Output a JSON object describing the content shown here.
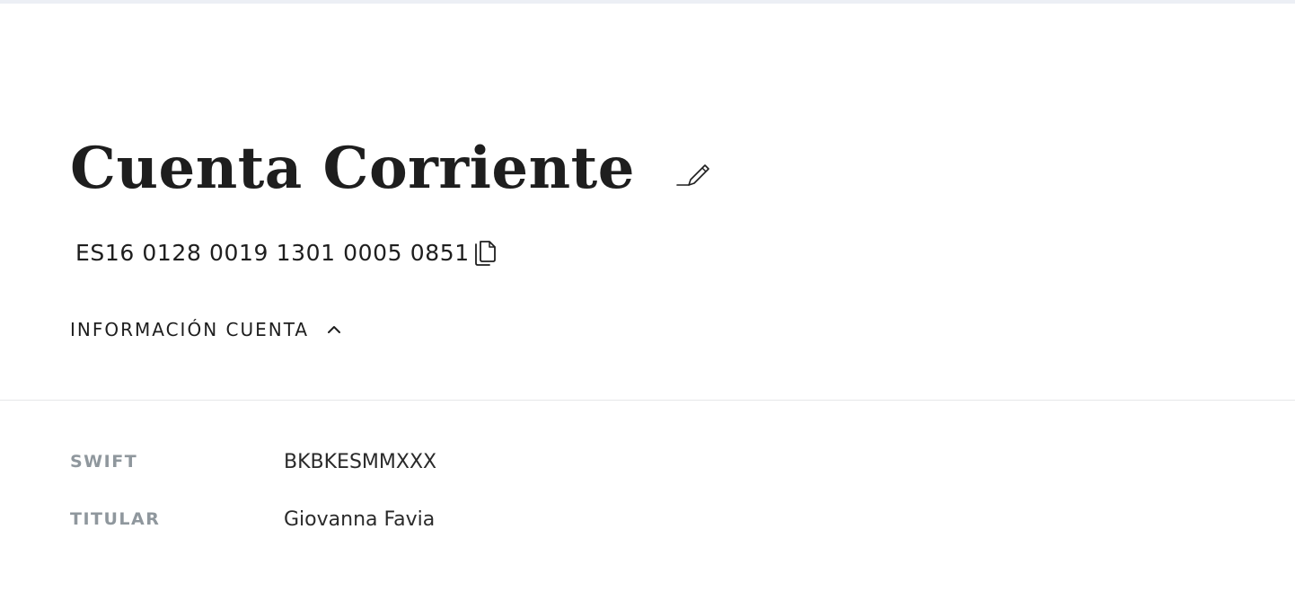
{
  "account": {
    "title": "Cuenta Corriente",
    "iban": "ES16 0128 0019 1301 0005 0851"
  },
  "info_toggle": {
    "label": "INFORMACIÓN CUENTA",
    "expanded": true
  },
  "details": [
    {
      "label": "SWIFT",
      "value": "BKBKESMMXXX"
    },
    {
      "label": "TITULAR",
      "value": "Giovanna Favia"
    }
  ],
  "icons": {
    "edit": "pencil-icon",
    "copy": "copy-icon",
    "toggle": "chevron-up-icon"
  },
  "colors": {
    "text": "#1e1e1e",
    "muted_label": "#8f979d",
    "divider": "#e6e7e9",
    "top_strip": "#eceff5"
  }
}
